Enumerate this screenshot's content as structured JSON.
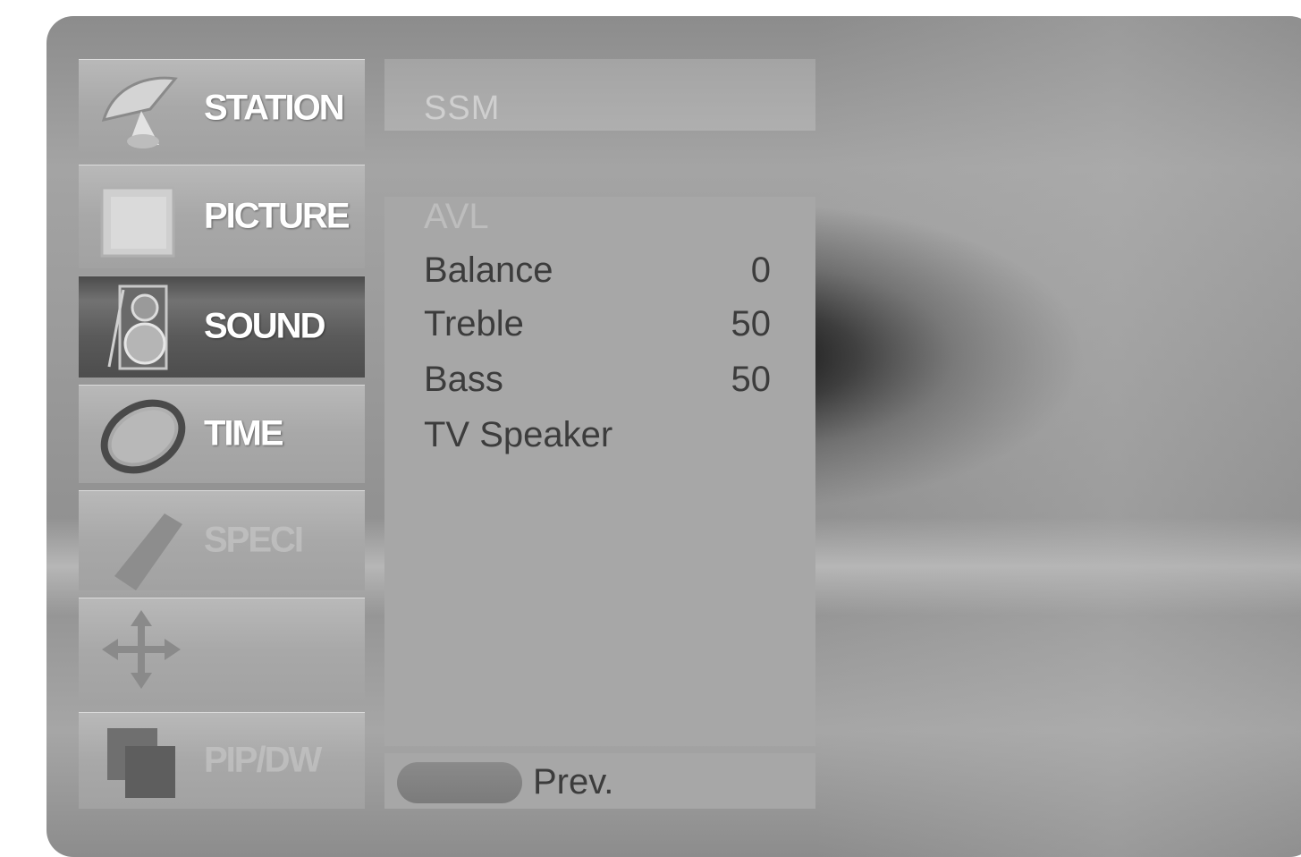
{
  "menu": {
    "items": [
      {
        "label": "STATION",
        "icon": "satellite-dish-icon",
        "state": "normal"
      },
      {
        "label": "PICTURE",
        "icon": "picture-screen-icon",
        "state": "normal"
      },
      {
        "label": "SOUND",
        "icon": "speaker-icon",
        "state": "selected"
      },
      {
        "label": "TIME",
        "icon": "clock-icon",
        "state": "normal"
      },
      {
        "label": "SPECI",
        "icon": "tag-icon",
        "state": "faded"
      },
      {
        "label": "",
        "icon": "move-arrows-icon",
        "state": "faded"
      },
      {
        "label": "PIP/DW",
        "icon": "pip-windows-icon",
        "state": "faded"
      }
    ]
  },
  "panel": {
    "title": "SSM",
    "options": [
      {
        "label": "AVL",
        "value": "",
        "dim": true
      },
      {
        "label": "Balance",
        "value": "0"
      },
      {
        "label": "Treble",
        "value": "50"
      },
      {
        "label": "Bass",
        "value": "50"
      },
      {
        "label": "TV Speaker",
        "value": ""
      }
    ]
  },
  "footer": {
    "prev_label": "Prev."
  }
}
